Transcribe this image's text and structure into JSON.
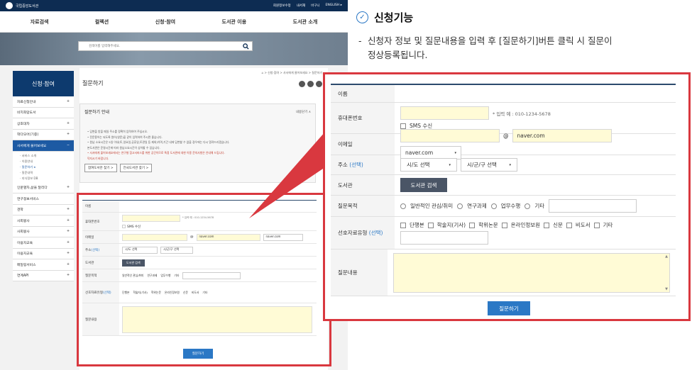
{
  "site": {
    "logo_text": "국립중앙도서관",
    "util_links": [
      "회원정보수정",
      "내서재",
      "바구니",
      "ENGLISH ▸"
    ],
    "gnb": [
      "자료검색",
      "컬렉션",
      "신청·참여",
      "도서관 이용",
      "도서관 소개"
    ],
    "search_placeholder": "검색어를 입력해주세요.",
    "side_title": "신청·참여",
    "side_items": [
      "자료신청안내",
      "비치희망도서",
      "상호대차",
      "학다모어(기증)",
      "사서에게 물어보세요"
    ],
    "side_sub": [
      "· 서비스 소개",
      "· 이용안내",
      "· 질문하기 ◂",
      "· 질문내역",
      "· 지식정보 DB"
    ],
    "side_items2": [
      "인문열차,삶을 달리다",
      "연구정보서비스",
      "견학",
      "사회봉사",
      "사회봉사",
      "이용자교육",
      "이용자교육",
      "메일링서비스",
      "연계API"
    ],
    "breadcrumb": "⌂ > 신청·참여 > 사서에게 물어보세요 > 질문하기",
    "page_title": "질문하기",
    "guide_title": "질문하기 안내",
    "guide_toggle": "내용닫기 ∧",
    "guide_lines": [
      "• 답변을 받을 메일 주소를 정확히 입력하여 주십시오.",
      "• 전문용어는 되도록 원어(영문)을 같이 입력하여 주시면 좋습니다.",
      "• 원남 소요시간은 5일 이내(토,일요일,공휴일,토관일 등 제외)이며,기간 내에 답변할 수 없을 경우에는 다시 알려드리겠습니다.",
      "  본도서관은 운영시간에 따라 원남소요시간이 상이할 수 있습니다.",
      "• 사서에게 물어보세요에서는 연구형 참고서비스를 위한 공간이므로 특정 도서관에 대한 이용 문의사항은 안내해 드립니다.",
      "  덕지시기 바랍니다."
    ],
    "guide_buttons": [
      "참여도서관 찾기 >",
      "전국도서관 찾기 >"
    ]
  },
  "right": {
    "title": "신청기능",
    "desc_dash": "-",
    "desc_line1": "신청자 정보 및 질문내용을 입력 후 [질문하기]버튼 클릭 시 질문이",
    "desc_line2": "정상등록됩니다."
  },
  "form": {
    "name_label": "이름",
    "phone_label": "휴대폰번호",
    "phone_hint": "* 입력 예 : 010-1234-5678",
    "sms_label": "SMS 수신",
    "email_label": "이메일",
    "email_at": "@",
    "email_domain": "naver.com",
    "email_select": "naver.com",
    "address_label": "주소",
    "address_optional": "(선택)",
    "sido": "시/도 선택",
    "sigungu": "시/군/구 선택",
    "library_label": "도서관",
    "library_button": "도서관 검색",
    "purpose_label": "질문목적",
    "purposes": [
      "일반적인 관심/취미",
      "연구과제",
      "업무수행",
      "기타"
    ],
    "type_label": "선호자료유형",
    "type_optional": "(선택)",
    "types": [
      "단행본",
      "학술지(기사)",
      "학위논문",
      "온라인정보원",
      "신문",
      "비도서",
      "기타"
    ],
    "content_label": "질문내용",
    "submit": "질문하기"
  },
  "colors": {
    "accent": "#2b78c5",
    "highlight": "#d9383f",
    "navy": "#0d2c52",
    "input_yellow": "#fffbd6"
  }
}
